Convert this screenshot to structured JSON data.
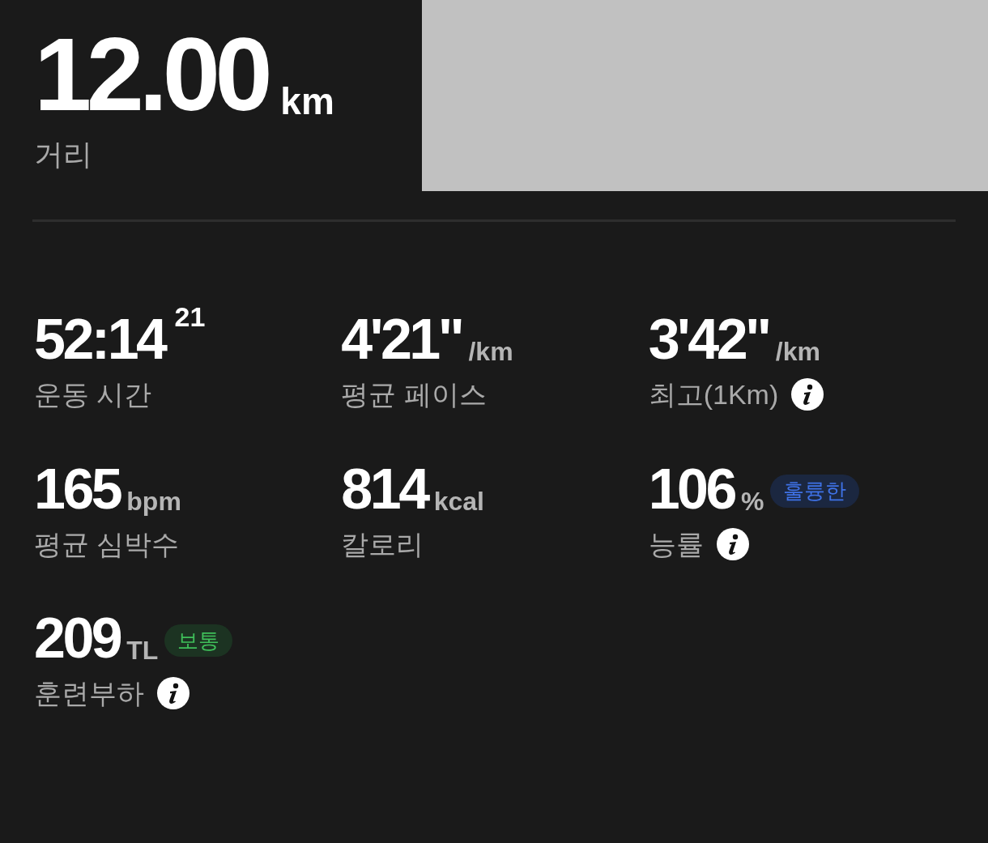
{
  "distance": {
    "value": "12.00",
    "unit": "km",
    "label": "거리"
  },
  "stats": [
    {
      "value": "52:14",
      "sup": "21",
      "label": "운동 시간",
      "info": false
    },
    {
      "value": "4'21\"",
      "unit": "/km",
      "label": "평균 페이스",
      "info": false
    },
    {
      "value": "3'42\"",
      "unit": "/km",
      "label": "최고(1Km)",
      "info": true
    },
    {
      "value": "165",
      "unit": "bpm",
      "label": "평균 심박수",
      "info": false
    },
    {
      "value": "814",
      "unit": "kcal",
      "label": "칼로리",
      "info": false
    },
    {
      "value": "106",
      "unit": "%",
      "badge": {
        "text": "훌륭한",
        "kind": "excellent"
      },
      "label": "능률",
      "info": true
    },
    {
      "value": "209",
      "unit": "TL",
      "badge": {
        "text": "보통",
        "kind": "normal"
      },
      "label": "훈련부하",
      "info": true
    }
  ]
}
